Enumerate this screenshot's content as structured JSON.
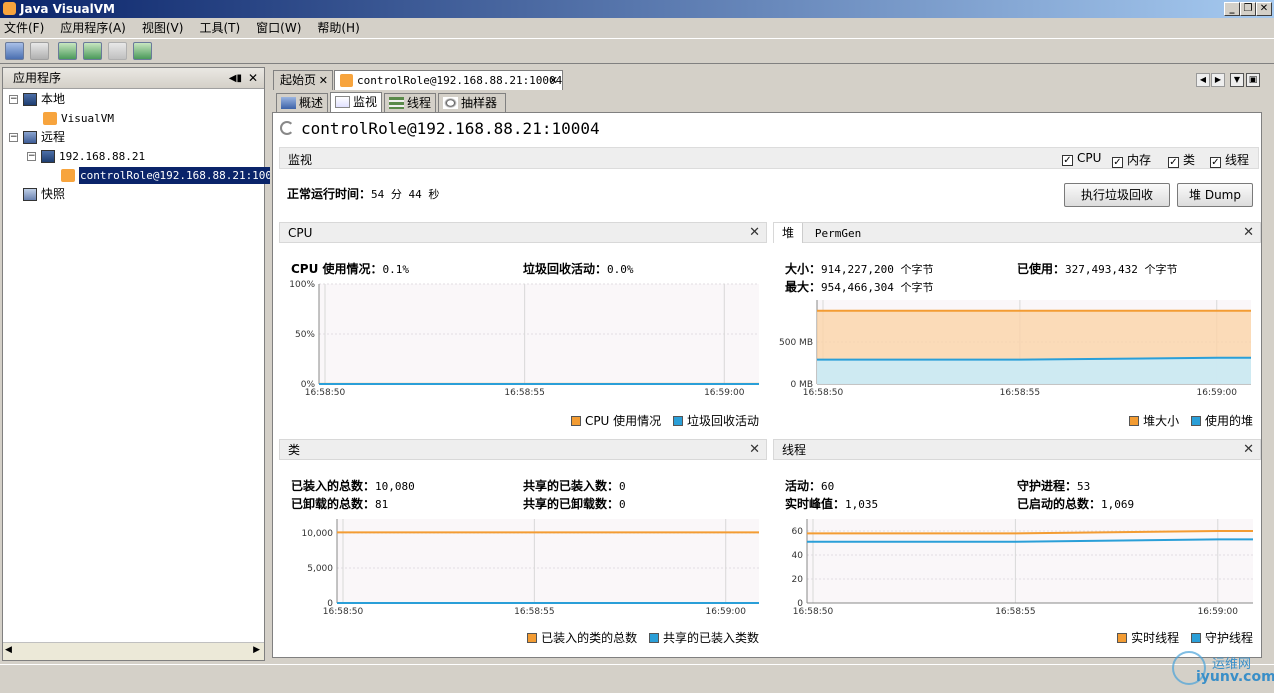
{
  "window": {
    "title": "Java VisualVM"
  },
  "menu": [
    "文件(F)",
    "应用程序(A)",
    "视图(V)",
    "工具(T)",
    "窗口(W)",
    "帮助(H)"
  ],
  "left_panel": {
    "title": "应用程序",
    "tree": {
      "local": "本地",
      "visualvm": "VisualVM",
      "remote": "远程",
      "host": "192.168.88.21",
      "jmx": "controlRole@192.168.88.21:10004",
      "snapshots": "快照"
    }
  },
  "doc_tabs": {
    "start": "起始页",
    "conn": "controlRole@192.168.88.21:10004"
  },
  "sub_tabs": [
    "概述",
    "监视",
    "线程",
    "抽样器"
  ],
  "page_title": "controlRole@192.168.88.21:10004",
  "monitor": {
    "label": "监视",
    "checks": [
      "CPU",
      "内存",
      "类",
      "线程"
    ],
    "uptime_label": "正常运行时间：",
    "uptime_value": "54 分 44 秒",
    "gc_button": "执行垃圾回收",
    "dump_button": "堆 Dump"
  },
  "cpu": {
    "title": "CPU",
    "usage_label": "CPU 使用情况：",
    "usage_value": "0.1%",
    "gc_label": "垃圾回收活动：",
    "gc_value": "0.0%",
    "legend": [
      "CPU 使用情况",
      "垃圾回收活动"
    ]
  },
  "heap": {
    "tab1": "堆",
    "tab2": "PermGen",
    "size_label": "大小：",
    "size_value": "914,227,200 个字节",
    "used_label": "已使用：",
    "used_value": "327,493,432 个字节",
    "max_label": "最大：",
    "max_value": "954,466,304 个字节",
    "legend": [
      "堆大小",
      "使用的堆"
    ]
  },
  "classes": {
    "title": "类",
    "loaded_label": "已装入的总数：",
    "loaded_value": "10,080",
    "shared_loaded_label": "共享的已装入数：",
    "shared_loaded_value": "0",
    "unloaded_label": "已卸载的总数：",
    "unloaded_value": "81",
    "shared_unloaded_label": "共享的已卸载数：",
    "shared_unloaded_value": "0",
    "legend": [
      "已装入的类的总数",
      "共享的已装入类数"
    ]
  },
  "threads": {
    "title": "线程",
    "live_label": "活动：",
    "live_value": "60",
    "daemon_label": "守护进程：",
    "daemon_value": "53",
    "peak_label": "实时峰值：",
    "peak_value": "1,035",
    "started_label": "已启动的总数：",
    "started_value": "1,069",
    "legend": [
      "实时线程",
      "守护线程"
    ]
  },
  "colors": {
    "orange": "#f39c33",
    "blue": "#2a9fd8",
    "orange_fill": "#fbd3a8",
    "blue_fill": "#c9ebf8"
  },
  "chart_data": [
    {
      "type": "area",
      "title": "CPU",
      "x": [
        "16:58:50",
        "16:58:55",
        "16:59:00"
      ],
      "ylabel": "",
      "yticks": [
        "0%",
        "50%",
        "100%"
      ],
      "ylim": [
        0,
        100
      ],
      "series": [
        {
          "name": "CPU 使用情况",
          "values": [
            0.1,
            0.1,
            0.1
          ]
        },
        {
          "name": "垃圾回收活动",
          "values": [
            0,
            0,
            0
          ]
        }
      ]
    },
    {
      "type": "area",
      "title": "堆",
      "x": [
        "16:58:50",
        "16:58:55",
        "16:59:00"
      ],
      "yticks": [
        "0 MB",
        "500 MB"
      ],
      "ylim": [
        0,
        1000
      ],
      "series": [
        {
          "name": "堆大小",
          "values": [
            872,
            872,
            872
          ]
        },
        {
          "name": "使用的堆",
          "values": [
            290,
            290,
            312
          ]
        }
      ]
    },
    {
      "type": "line",
      "title": "类",
      "x": [
        "16:58:50",
        "16:58:55",
        "16:59:00"
      ],
      "yticks": [
        "0",
        "5,000",
        "10,000"
      ],
      "ylim": [
        0,
        12000
      ],
      "series": [
        {
          "name": "已装入的类的总数",
          "values": [
            10080,
            10080,
            10080
          ]
        },
        {
          "name": "共享的已装入类数",
          "values": [
            0,
            0,
            0
          ]
        }
      ]
    },
    {
      "type": "line",
      "title": "线程",
      "x": [
        "16:58:50",
        "16:58:55",
        "16:59:00"
      ],
      "yticks": [
        "0",
        "20",
        "40",
        "60"
      ],
      "ylim": [
        0,
        70
      ],
      "series": [
        {
          "name": "实时线程",
          "values": [
            58,
            58,
            60
          ]
        },
        {
          "name": "守护线程",
          "values": [
            51,
            51,
            53
          ]
        }
      ]
    }
  ],
  "watermark": {
    "text1": "运维网",
    "text2": "iyunv.com"
  }
}
